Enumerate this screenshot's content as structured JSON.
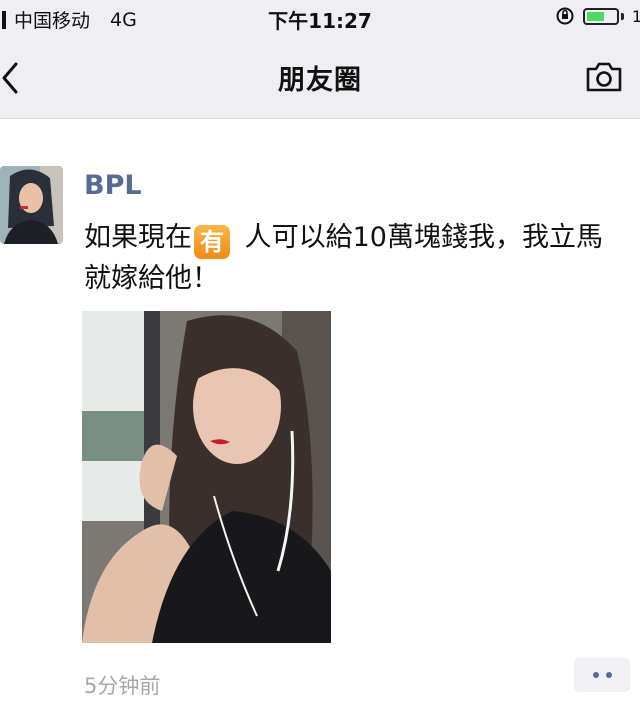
{
  "status_bar": {
    "carrier": "中国移动",
    "network": "4G",
    "time": "下午11:27",
    "trailing_char": "1"
  },
  "nav": {
    "title": "朋友圈",
    "back_icon": "chevron-left-icon",
    "camera_icon": "camera-icon"
  },
  "post": {
    "username": "BPL",
    "text_part1": "如果現在",
    "emoji_char": "有",
    "text_part2": " 人可以給10萬塊錢我，我立馬就嫁給他！",
    "timestamp": "5分钟前"
  },
  "colors": {
    "link": "#576b95",
    "header_bg": "#efeff3",
    "emoji_bg": "#f29a2e",
    "battery": "#4cd964"
  }
}
